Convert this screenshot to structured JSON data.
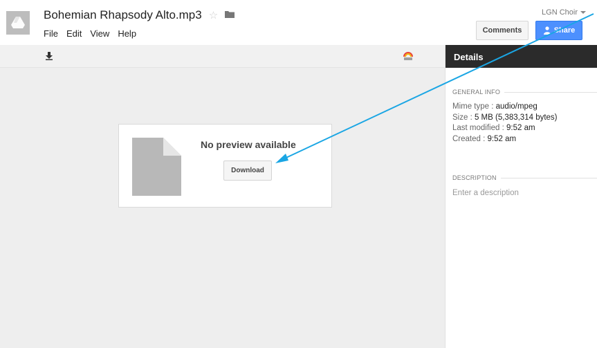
{
  "header": {
    "title": "Bohemian Rhapsody Alto.mp3",
    "account_label": "LGN Choir",
    "comments_label": "Comments",
    "share_label": "Share",
    "menu": [
      "File",
      "Edit",
      "View",
      "Help"
    ]
  },
  "toolbar": {
    "download_icon": "download-icon",
    "open_with_icon": "open-with-icon"
  },
  "preview": {
    "message": "No preview available",
    "download_label": "Download"
  },
  "details": {
    "heading": "Details",
    "general_info_title": "General info",
    "rows": [
      {
        "label": "Mime type",
        "value": "audio/mpeg"
      },
      {
        "label": "Size",
        "value": "5 MB (5,383,314 bytes)"
      },
      {
        "label": "Last modified",
        "value": "9:52 am"
      },
      {
        "label": "Created",
        "value": "9:52 am"
      }
    ],
    "description_title": "Description",
    "description_placeholder": "Enter a description"
  },
  "colors": {
    "share_blue": "#4d90fe",
    "details_header": "#2b2b2b",
    "annotation_arrow": "#1aa6e4"
  }
}
